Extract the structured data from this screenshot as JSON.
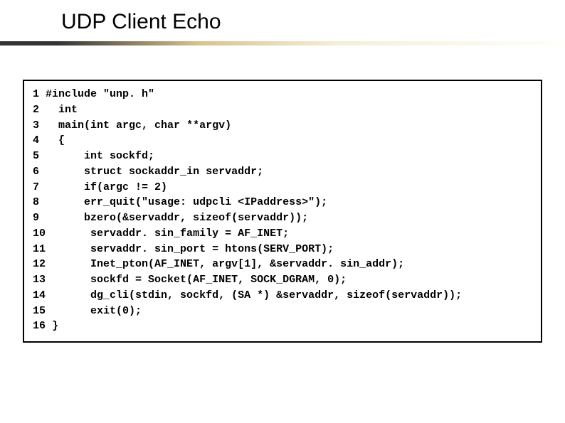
{
  "title": "UDP Client Echo",
  "code": {
    "lines": [
      {
        "n": "1",
        "text": "#include \"unp. h\""
      },
      {
        "n": "2",
        "text": "  int"
      },
      {
        "n": "3",
        "text": "  main(int argc, char **argv)"
      },
      {
        "n": "4",
        "text": "  {"
      },
      {
        "n": "5",
        "text": "      int sockfd;"
      },
      {
        "n": "6",
        "text": "      struct sockaddr_in servaddr;"
      },
      {
        "n": "7",
        "text": "      if(argc != 2)"
      },
      {
        "n": "8",
        "text": "      err_quit(\"usage: udpcli <IPaddress>\");"
      },
      {
        "n": "9",
        "text": "      bzero(&servaddr, sizeof(servaddr));"
      },
      {
        "n": "10",
        "text": "      servaddr. sin_family = AF_INET;"
      },
      {
        "n": "11",
        "text": "      servaddr. sin_port = htons(SERV_PORT);"
      },
      {
        "n": "12",
        "text": "      Inet_pton(AF_INET, argv[1], &servaddr. sin_addr);"
      },
      {
        "n": "13",
        "text": "      sockfd = Socket(AF_INET, SOCK_DGRAM, 0);"
      },
      {
        "n": "14",
        "text": "      dg_cli(stdin, sockfd, (SA *) &servaddr, sizeof(servaddr));"
      },
      {
        "n": "15",
        "text": "      exit(0);"
      },
      {
        "n": "16",
        "text": "}"
      }
    ]
  }
}
